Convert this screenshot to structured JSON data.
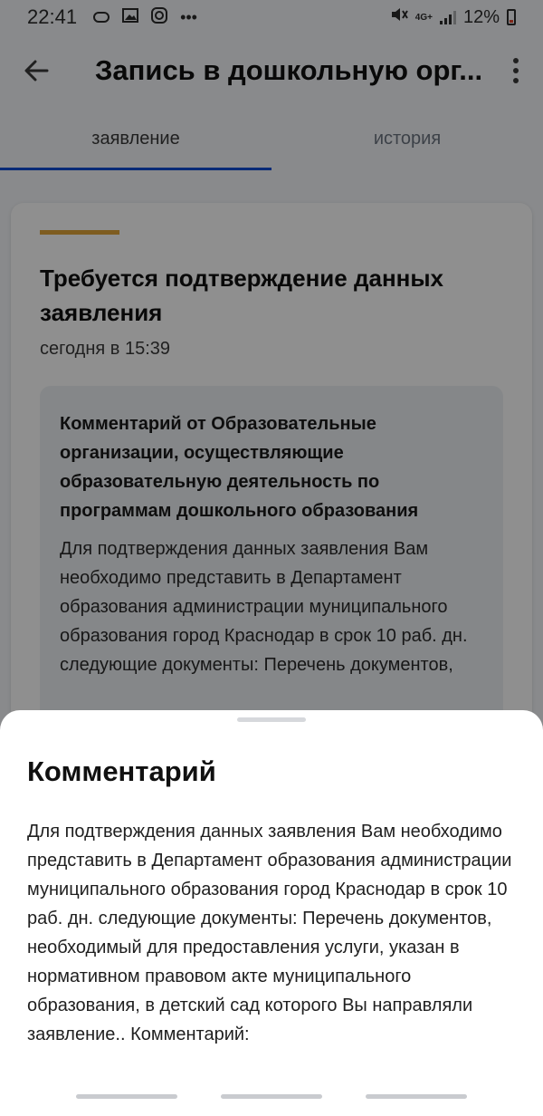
{
  "status_bar": {
    "time": "22:41",
    "network": "4G+",
    "battery": "12%"
  },
  "app_bar": {
    "title": "Запись в дошкольную орг..."
  },
  "tabs": [
    {
      "label": "заявление",
      "active": true
    },
    {
      "label": "история",
      "active": false
    }
  ],
  "card": {
    "title": "Требуется подтверждение данных заявления",
    "timestamp": "сегодня в 15:39",
    "comment": {
      "author": "Комментарий от Образовательные организации, осуществляющие образовательную деятельность по программам дошкольного образования",
      "body": "Для подтверждения данных заявления Вам необходимо представить в Департамент образования администрации муниципального образования город Краснодар в срок 10 раб. дн. следующие документы: Перечень документов,"
    }
  },
  "sheet": {
    "title": "Комментарий",
    "body": "Для подтверждения данных заявления Вам необходимо представить в Департамент образования администрации муниципального образования город Краснодар в срок 10 раб. дн. следующие документы: Перечень документов, необходимый для предоставления услуги, указан в нормативном правовом акте муниципального образования, в детский сад которого Вы направляли заявление.. Комментарий:"
  },
  "colors": {
    "accent_line": "#e0a43a",
    "tab_indicator": "#0d4cd3",
    "battery_low": "#e0452b"
  },
  "icons": {
    "back": "arrow-left-icon",
    "more": "more-vertical-icon"
  }
}
